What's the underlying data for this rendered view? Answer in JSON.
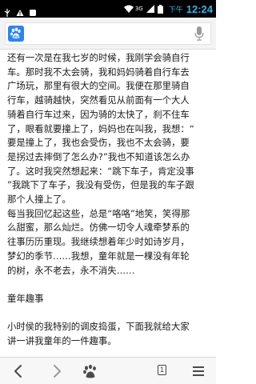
{
  "status_bar": {
    "time": "12:24",
    "am_pm": "下午",
    "signal_label": "3G"
  },
  "article": {
    "lines": [
      "还有一次是在我七岁的时候，我刚学会骑自行",
      "车。那时我不太会骑，我和妈妈骑着自行车去",
      "广场玩，那里有很大的空间。我便在那里骑自",
      "行车，越骑越快，突然看见从前面有一个大人",
      "骑着自行车过来，因为骑的太快了，刹不住车",
      "了，眼看就要撞上了，妈妈也在叫我，我想：“",
      "要是撞上了，我也会受伤，我也不太会骑，要",
      "是拐过去摔倒了怎么办?”我也不知道该怎么办",
      "了。这时我突然想起来：“跳下车子，肯定没事",
      "”我跳下了车子，我没有受伤，但是我的车子跟",
      "那个人撞上了。",
      "每当我回忆起这些，总是“咯咯”地笑，笑得那",
      "么甜蜜，那么灿烂。仿佛一切令人魂牵梦系的",
      "往事历历重现。我继续想着年少时如诗岁月，",
      "梦幻的季节……我想，童年就是一棵没有年轮",
      "的树，永不老去，永不消失……"
    ],
    "heading": "童年趣事",
    "closing_lines": [
      "小时侯的我特别的调皮捣蛋，下面我就给大家",
      "讲一讲我童年的一件趣事。"
    ]
  },
  "nav": {
    "tab_count": "1",
    "icons": [
      "back-arrow-icon",
      "forward-arrow-icon",
      "baidu-paw-icon",
      "tabs-icon",
      "menu-icon"
    ]
  },
  "colors": {
    "accent": "#33b5e5",
    "brand": "#2b83f6"
  }
}
